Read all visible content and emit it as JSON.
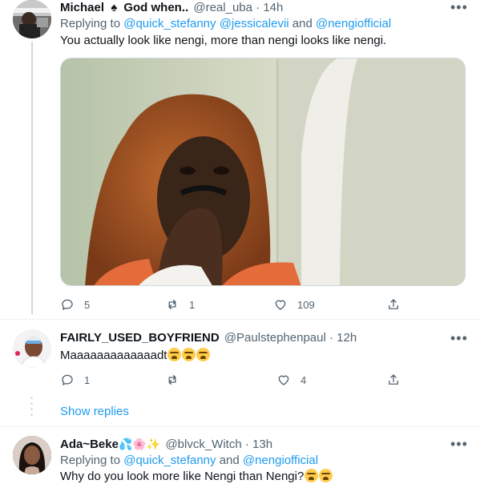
{
  "tweet1": {
    "display_name": "Michael",
    "name_suffix": "God when..",
    "spade_emoji": "♠",
    "handle": "@real_uba",
    "dot": "·",
    "time": "14h",
    "replying_prefix": "Replying to",
    "mention1": "@quick_stefanny",
    "mention2": "@jessicalevii",
    "and_word": "and",
    "mention3": "@nengiofficial",
    "text": "You actually look like nengi, more than nengi looks like nengi.",
    "replies": "5",
    "retweets": "1",
    "likes": "109"
  },
  "tweet2": {
    "display_name": "FAIRLY_USED_BOYFRIEND",
    "handle": "@Paulstephenpaul",
    "dot": "·",
    "time": "12h",
    "text": "Maaaaaaaaaaaaadt",
    "emoji_count": 3,
    "replies": "1",
    "retweets": "",
    "likes": "4",
    "show_replies": "Show replies"
  },
  "tweet3": {
    "display_name": "Ada~Beke",
    "name_emojis": "💦🌸✨",
    "handle": "@blvck_Witch",
    "dot": "·",
    "time": "13h",
    "replying_prefix": "Replying to",
    "mention1": "@quick_stefanny",
    "and_word": "and",
    "mention2": "@nengiofficial",
    "text": "Why do you look more like Nengi than Nengi?"
  },
  "icons": {
    "more": "more-horizontal-icon",
    "reply": "reply-icon",
    "retweet": "retweet-icon",
    "like": "heart-icon",
    "share": "share-icon"
  },
  "colors": {
    "accent": "#1d9bf0",
    "secondary_text": "#536471",
    "primary_text": "#0f1419"
  }
}
